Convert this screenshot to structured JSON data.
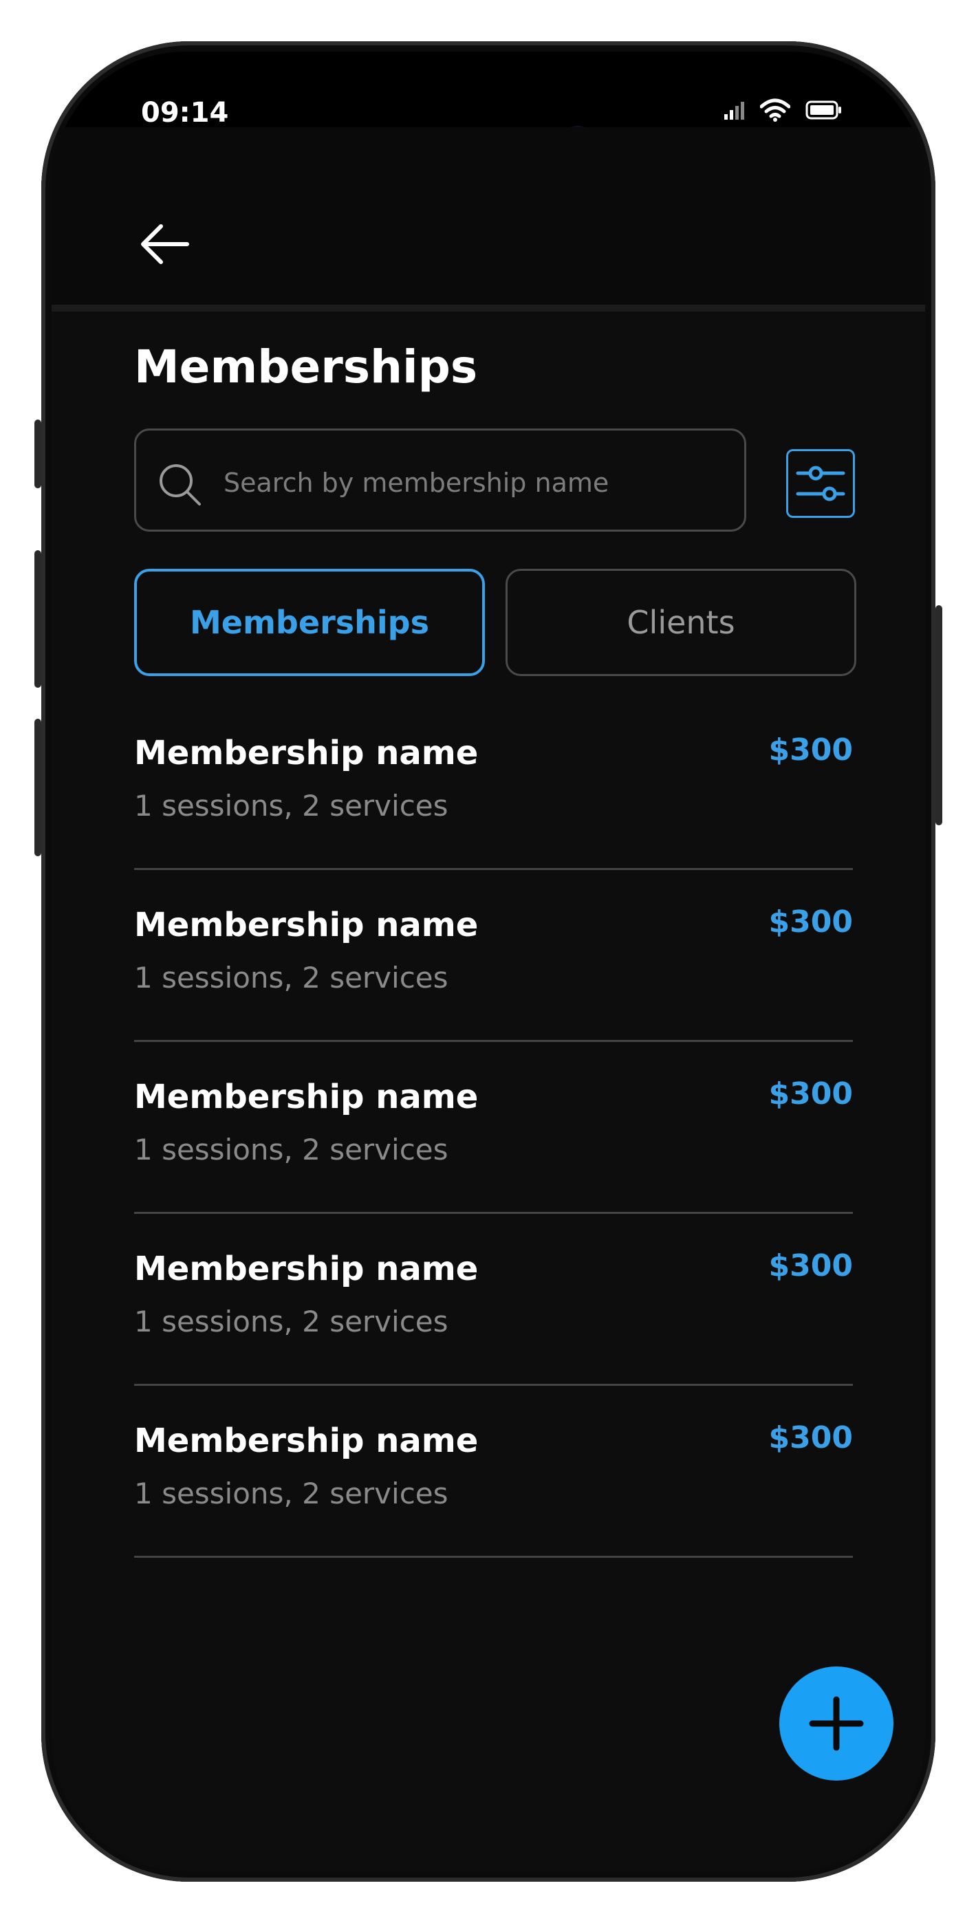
{
  "status_bar": {
    "time": "09:14",
    "icons": [
      "signal-icon",
      "wifi-icon",
      "battery-icon"
    ]
  },
  "header": {
    "back_icon": "arrow-left-icon",
    "title": "Memberships"
  },
  "search": {
    "placeholder": "Search by membership name",
    "value": ""
  },
  "tabs": [
    {
      "label": "Memberships",
      "active": true
    },
    {
      "label": "Clients",
      "active": false
    }
  ],
  "items": [
    {
      "name": "Membership name",
      "details": "1 sessions, 2 services",
      "price": "$300"
    },
    {
      "name": "Membership name",
      "details": "1 sessions, 2 services",
      "price": "$300"
    },
    {
      "name": "Membership name",
      "details": "1 sessions, 2 services",
      "price": "$300"
    },
    {
      "name": "Membership name",
      "details": "1 sessions, 2 services",
      "price": "$300"
    },
    {
      "name": "Membership name",
      "details": "1 sessions, 2 services",
      "price": "$300"
    }
  ],
  "fab_icon": "plus-icon",
  "colors": {
    "accent": "#3aa0e8",
    "fab": "#1aa0f5",
    "background": "#0d0d0d",
    "text": "#ffffff",
    "muted": "#8a8a8a",
    "divider": "#444444"
  }
}
